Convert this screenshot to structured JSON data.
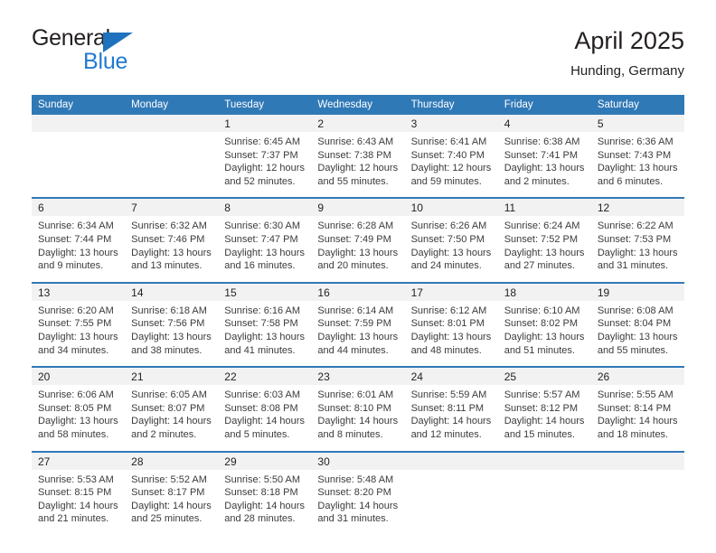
{
  "brand": {
    "name_part1": "General",
    "name_part2": "Blue",
    "accent_color": "#1f7ad1",
    "triangle_color": "#1f72bd"
  },
  "header": {
    "title": "April 2025",
    "subtitle": "Hunding, Germany",
    "header_bg": "#3079b7"
  },
  "columns": [
    "Sunday",
    "Monday",
    "Tuesday",
    "Wednesday",
    "Thursday",
    "Friday",
    "Saturday"
  ],
  "weeks": [
    {
      "days": [
        {
          "num": "",
          "sunrise": "",
          "sunset": "",
          "daylight1": "",
          "daylight2": ""
        },
        {
          "num": "",
          "sunrise": "",
          "sunset": "",
          "daylight1": "",
          "daylight2": ""
        },
        {
          "num": "1",
          "sunrise": "Sunrise: 6:45 AM",
          "sunset": "Sunset: 7:37 PM",
          "daylight1": "Daylight: 12 hours",
          "daylight2": "and 52 minutes."
        },
        {
          "num": "2",
          "sunrise": "Sunrise: 6:43 AM",
          "sunset": "Sunset: 7:38 PM",
          "daylight1": "Daylight: 12 hours",
          "daylight2": "and 55 minutes."
        },
        {
          "num": "3",
          "sunrise": "Sunrise: 6:41 AM",
          "sunset": "Sunset: 7:40 PM",
          "daylight1": "Daylight: 12 hours",
          "daylight2": "and 59 minutes."
        },
        {
          "num": "4",
          "sunrise": "Sunrise: 6:38 AM",
          "sunset": "Sunset: 7:41 PM",
          "daylight1": "Daylight: 13 hours",
          "daylight2": "and 2 minutes."
        },
        {
          "num": "5",
          "sunrise": "Sunrise: 6:36 AM",
          "sunset": "Sunset: 7:43 PM",
          "daylight1": "Daylight: 13 hours",
          "daylight2": "and 6 minutes."
        }
      ]
    },
    {
      "days": [
        {
          "num": "6",
          "sunrise": "Sunrise: 6:34 AM",
          "sunset": "Sunset: 7:44 PM",
          "daylight1": "Daylight: 13 hours",
          "daylight2": "and 9 minutes."
        },
        {
          "num": "7",
          "sunrise": "Sunrise: 6:32 AM",
          "sunset": "Sunset: 7:46 PM",
          "daylight1": "Daylight: 13 hours",
          "daylight2": "and 13 minutes."
        },
        {
          "num": "8",
          "sunrise": "Sunrise: 6:30 AM",
          "sunset": "Sunset: 7:47 PM",
          "daylight1": "Daylight: 13 hours",
          "daylight2": "and 16 minutes."
        },
        {
          "num": "9",
          "sunrise": "Sunrise: 6:28 AM",
          "sunset": "Sunset: 7:49 PM",
          "daylight1": "Daylight: 13 hours",
          "daylight2": "and 20 minutes."
        },
        {
          "num": "10",
          "sunrise": "Sunrise: 6:26 AM",
          "sunset": "Sunset: 7:50 PM",
          "daylight1": "Daylight: 13 hours",
          "daylight2": "and 24 minutes."
        },
        {
          "num": "11",
          "sunrise": "Sunrise: 6:24 AM",
          "sunset": "Sunset: 7:52 PM",
          "daylight1": "Daylight: 13 hours",
          "daylight2": "and 27 minutes."
        },
        {
          "num": "12",
          "sunrise": "Sunrise: 6:22 AM",
          "sunset": "Sunset: 7:53 PM",
          "daylight1": "Daylight: 13 hours",
          "daylight2": "and 31 minutes."
        }
      ]
    },
    {
      "days": [
        {
          "num": "13",
          "sunrise": "Sunrise: 6:20 AM",
          "sunset": "Sunset: 7:55 PM",
          "daylight1": "Daylight: 13 hours",
          "daylight2": "and 34 minutes."
        },
        {
          "num": "14",
          "sunrise": "Sunrise: 6:18 AM",
          "sunset": "Sunset: 7:56 PM",
          "daylight1": "Daylight: 13 hours",
          "daylight2": "and 38 minutes."
        },
        {
          "num": "15",
          "sunrise": "Sunrise: 6:16 AM",
          "sunset": "Sunset: 7:58 PM",
          "daylight1": "Daylight: 13 hours",
          "daylight2": "and 41 minutes."
        },
        {
          "num": "16",
          "sunrise": "Sunrise: 6:14 AM",
          "sunset": "Sunset: 7:59 PM",
          "daylight1": "Daylight: 13 hours",
          "daylight2": "and 44 minutes."
        },
        {
          "num": "17",
          "sunrise": "Sunrise: 6:12 AM",
          "sunset": "Sunset: 8:01 PM",
          "daylight1": "Daylight: 13 hours",
          "daylight2": "and 48 minutes."
        },
        {
          "num": "18",
          "sunrise": "Sunrise: 6:10 AM",
          "sunset": "Sunset: 8:02 PM",
          "daylight1": "Daylight: 13 hours",
          "daylight2": "and 51 minutes."
        },
        {
          "num": "19",
          "sunrise": "Sunrise: 6:08 AM",
          "sunset": "Sunset: 8:04 PM",
          "daylight1": "Daylight: 13 hours",
          "daylight2": "and 55 minutes."
        }
      ]
    },
    {
      "days": [
        {
          "num": "20",
          "sunrise": "Sunrise: 6:06 AM",
          "sunset": "Sunset: 8:05 PM",
          "daylight1": "Daylight: 13 hours",
          "daylight2": "and 58 minutes."
        },
        {
          "num": "21",
          "sunrise": "Sunrise: 6:05 AM",
          "sunset": "Sunset: 8:07 PM",
          "daylight1": "Daylight: 14 hours",
          "daylight2": "and 2 minutes."
        },
        {
          "num": "22",
          "sunrise": "Sunrise: 6:03 AM",
          "sunset": "Sunset: 8:08 PM",
          "daylight1": "Daylight: 14 hours",
          "daylight2": "and 5 minutes."
        },
        {
          "num": "23",
          "sunrise": "Sunrise: 6:01 AM",
          "sunset": "Sunset: 8:10 PM",
          "daylight1": "Daylight: 14 hours",
          "daylight2": "and 8 minutes."
        },
        {
          "num": "24",
          "sunrise": "Sunrise: 5:59 AM",
          "sunset": "Sunset: 8:11 PM",
          "daylight1": "Daylight: 14 hours",
          "daylight2": "and 12 minutes."
        },
        {
          "num": "25",
          "sunrise": "Sunrise: 5:57 AM",
          "sunset": "Sunset: 8:12 PM",
          "daylight1": "Daylight: 14 hours",
          "daylight2": "and 15 minutes."
        },
        {
          "num": "26",
          "sunrise": "Sunrise: 5:55 AM",
          "sunset": "Sunset: 8:14 PM",
          "daylight1": "Daylight: 14 hours",
          "daylight2": "and 18 minutes."
        }
      ]
    },
    {
      "days": [
        {
          "num": "27",
          "sunrise": "Sunrise: 5:53 AM",
          "sunset": "Sunset: 8:15 PM",
          "daylight1": "Daylight: 14 hours",
          "daylight2": "and 21 minutes."
        },
        {
          "num": "28",
          "sunrise": "Sunrise: 5:52 AM",
          "sunset": "Sunset: 8:17 PM",
          "daylight1": "Daylight: 14 hours",
          "daylight2": "and 25 minutes."
        },
        {
          "num": "29",
          "sunrise": "Sunrise: 5:50 AM",
          "sunset": "Sunset: 8:18 PM",
          "daylight1": "Daylight: 14 hours",
          "daylight2": "and 28 minutes."
        },
        {
          "num": "30",
          "sunrise": "Sunrise: 5:48 AM",
          "sunset": "Sunset: 8:20 PM",
          "daylight1": "Daylight: 14 hours",
          "daylight2": "and 31 minutes."
        },
        {
          "num": "",
          "sunrise": "",
          "sunset": "",
          "daylight1": "",
          "daylight2": ""
        },
        {
          "num": "",
          "sunrise": "",
          "sunset": "",
          "daylight1": "",
          "daylight2": ""
        },
        {
          "num": "",
          "sunrise": "",
          "sunset": "",
          "daylight1": "",
          "daylight2": ""
        }
      ]
    }
  ]
}
